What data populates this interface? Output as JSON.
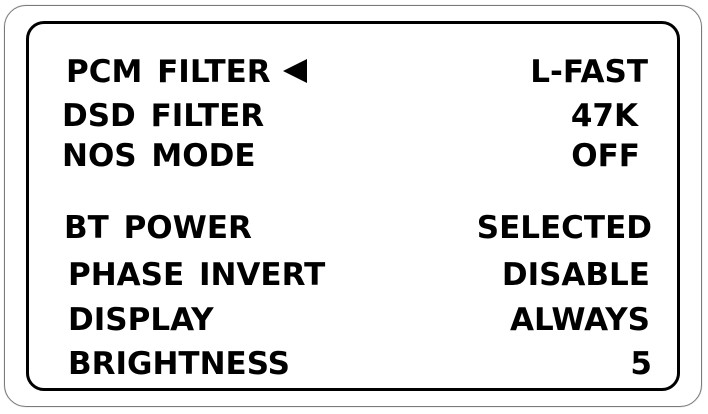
{
  "menu": {
    "items": [
      {
        "label": "PCM FILTER",
        "value": "L-FAST",
        "selected": true
      },
      {
        "label": "DSD FILTER",
        "value": "47K"
      },
      {
        "label": "NOS MODE",
        "value": "OFF"
      },
      {
        "label": "BT POWER",
        "value": "SELECTED"
      },
      {
        "label": "PHASE INVERT",
        "value": "DISABLE"
      },
      {
        "label": "DISPLAY",
        "value": "ALWAYS"
      },
      {
        "label": "BRIGHTNESS",
        "value": "5"
      }
    ],
    "cursor_icon": "left-pointing-triangle"
  }
}
